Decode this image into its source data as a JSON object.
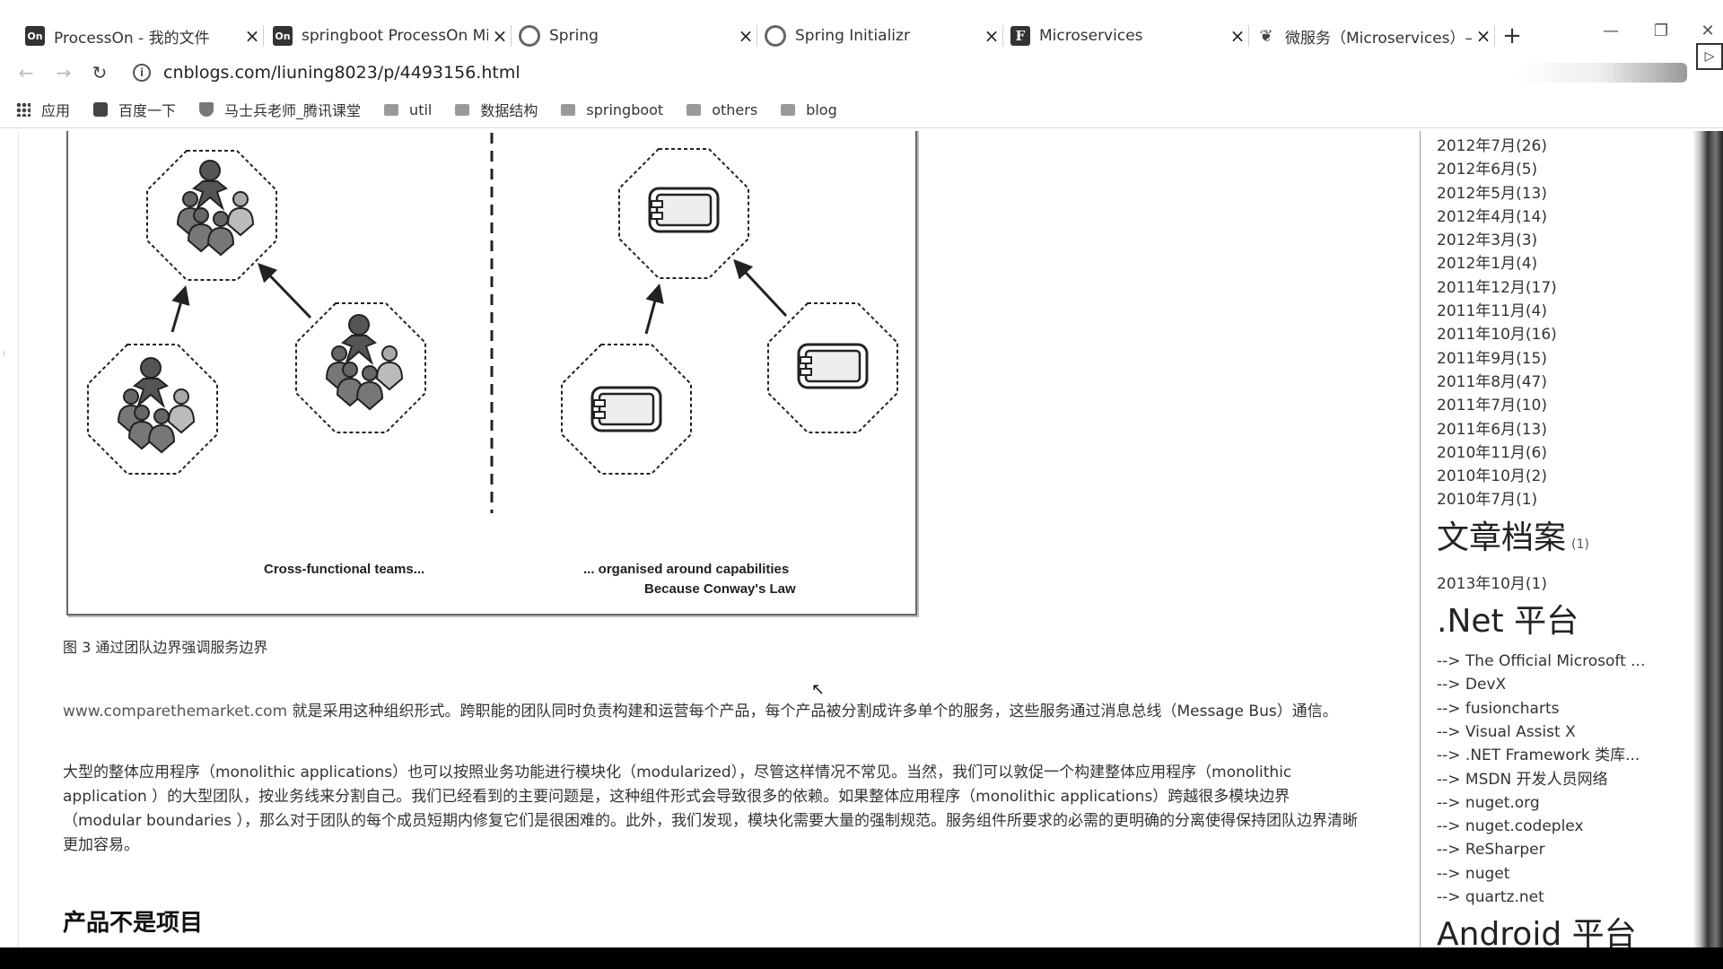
{
  "tabs": [
    {
      "title": "ProcessOn - 我的文件",
      "icon": "processon-icon",
      "fav": "On"
    },
    {
      "title": "springboot ProcessOn Mi",
      "icon": "processon-icon",
      "fav": "On"
    },
    {
      "title": "Spring",
      "icon": "spring-icon",
      "fav": ""
    },
    {
      "title": "Spring Initializr",
      "icon": "spring-initializr-icon",
      "fav": ""
    },
    {
      "title": "Microservices",
      "icon": "fowler-icon",
      "fav": "F"
    },
    {
      "title": "微服务（Microservices）—",
      "icon": "cnblogs-icon",
      "fav": ""
    }
  ],
  "address": {
    "url": "cnblogs.com/liuning8023/p/4493156.html"
  },
  "bookmarks": [
    "应用",
    "百度一下",
    "马士兵老师_腾讯课堂",
    "util",
    "数据结构",
    "springboot",
    "others",
    "blog"
  ],
  "figure": {
    "label_left": "Cross-functional teams...",
    "label_right_1": "... organised around capabilities",
    "label_right_2": "Because Conway's Law"
  },
  "caption": "图 3 通过团队边界强调服务边界",
  "paragraphs": {
    "p1_link": "www.comparethemarket.com",
    "p1_text": " 就是采用这种组织形式。跨职能的团队同时负责构建和运营每个产品，每个产品被分割成许多单个的服务，这些服务通过消息总线（Message Bus）通信。",
    "p2": "大型的整体应用程序（monolithic applications）也可以按照业务功能进行模块化（modularized），尽管这样情况不常见。当然，我们可以敦促一个构建整体应用程序（monolithic application ）的大型团队，按业务线来分割自己。我们已经看到的主要问题是，这种组件形式会导致很多的依赖。如果整体应用程序（monolithic applications）跨越很多模块边界（modular boundaries ），那么对于团队的每个成员短期内修复它们是很困难的。此外，我们发现，模块化需要大量的强制规范。服务组件所要求的必需的更明确的分离使得保持团队边界清晰更加容易。"
  },
  "heading": "产品不是项目",
  "sidebar": {
    "archive": [
      "2012年7月(26)",
      "2012年6月(5)",
      "2012年5月(13)",
      "2012年4月(14)",
      "2012年3月(3)",
      "2012年1月(4)",
      "2011年12月(17)",
      "2011年11月(4)",
      "2011年10月(16)",
      "2011年9月(15)",
      "2011年8月(47)",
      "2011年7月(10)",
      "2011年6月(13)",
      "2010年11月(6)",
      "2010年10月(2)",
      "2010年7月(1)"
    ],
    "article_archive_title": "文章档案",
    "article_archive_count": "(1)",
    "article_archive": [
      "2013年10月(1)"
    ],
    "net_title": ".Net 平台",
    "net_links": [
      "--> The Official Microsoft ...",
      "--> DevX",
      "--> fusioncharts",
      "--> Visual Assist X",
      "--> .NET Framework 类库...",
      "--> MSDN 开发人员网络",
      "--> nuget.org",
      "--> nuget.codeplex",
      "--> ReSharper",
      "--> nuget",
      "--> quartz.net"
    ],
    "android_title": "Android 平台"
  }
}
